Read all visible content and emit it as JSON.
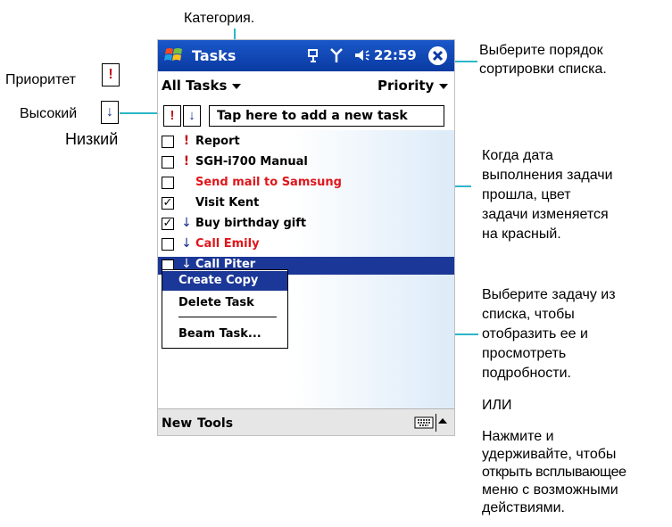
{
  "annotations": {
    "category": "Категория.",
    "priority": "Приоритет",
    "high": "Высокий",
    "low": "Низкий",
    "sort": [
      "Выберите порядок",
      "сортировки списка."
    ],
    "overdue": [
      "Когда дата",
      "выполнения задачи",
      "прошла, цвет",
      "задачи изменяется",
      "на красный."
    ],
    "select": [
      "Выберите задачу из",
      "списка, чтобы",
      "отобразить ее и",
      "просмотреть",
      "подробности."
    ],
    "or": "ИЛИ",
    "hold": [
      "Нажмите и",
      "удерживайте, чтобы",
      "открыть всплывающее",
      "меню с возможными",
      "действиями."
    ]
  },
  "titlebar": {
    "app": "Tasks",
    "time": "22:59"
  },
  "toolbar": {
    "category": "All Tasks",
    "sort": "Priority"
  },
  "entry": {
    "high_glyph": "!",
    "low_glyph": "↓",
    "placeholder": "Tap here to add a new task"
  },
  "tasks": [
    {
      "label": "Report",
      "priority": "!",
      "checked": false,
      "overdue": false
    },
    {
      "label": "SGH-i700 Manual",
      "priority": "!",
      "checked": false,
      "overdue": false
    },
    {
      "label": "Send mail to Samsung",
      "priority": "",
      "checked": false,
      "overdue": true
    },
    {
      "label": "Visit Kent",
      "priority": "",
      "checked": true,
      "overdue": false
    },
    {
      "label": "Buy birthday gift",
      "priority": "↓",
      "checked": true,
      "overdue": false
    },
    {
      "label": "Call Emily",
      "priority": "↓",
      "checked": false,
      "overdue": true
    },
    {
      "label": "Call Piter",
      "priority": "↓",
      "checked": false,
      "overdue": false
    }
  ],
  "popup": {
    "items": [
      "Create Copy",
      "Delete Task",
      "Beam Task..."
    ]
  },
  "bottom": {
    "new": "New",
    "tools": "Tools"
  }
}
